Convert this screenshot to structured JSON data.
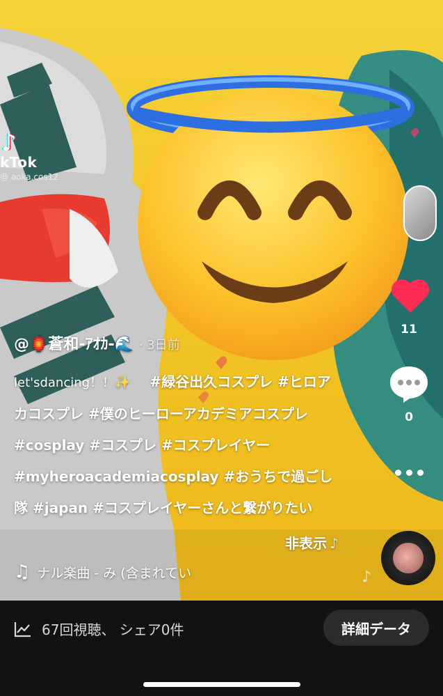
{
  "watermark": {
    "logo_glyph": "♪",
    "app_name": "kTok",
    "handle": "@ aoka.cos12"
  },
  "author": {
    "name": "@🏮蒼和-ｱｵｶ-🌊",
    "date": "· 3日前"
  },
  "caption": {
    "intro": "let'sdancing！！✨",
    "hashtags": "#緑谷出久コスプレ #ヒロアカコスプレ #僕のヒーローアカデミアコスプレ #cosplay #コスプレ #コスプレイヤー #myheroacademiacosplay #おうちで過ごし隊 #japan #コスプレイヤーさんと繋がりたい"
  },
  "hide_label": "非表示",
  "sound": {
    "icon": "♫",
    "title": "ナル楽曲 - み (含まれてい"
  },
  "rail": {
    "like_count": "11",
    "comment_count": "0"
  },
  "bottom_bar": {
    "stats_text": "67回視聴、 シェア0件",
    "details_label": "詳細データ"
  },
  "colors": {
    "background": "#f2c626",
    "heart": "#fe2c55",
    "bottom_bar": "#121212"
  },
  "icons": [
    "tiktok-logo-icon",
    "heart-icon",
    "comment-icon",
    "more-icon",
    "music-note-icon",
    "stats-chart-icon",
    "angel-emoji-icon"
  ]
}
